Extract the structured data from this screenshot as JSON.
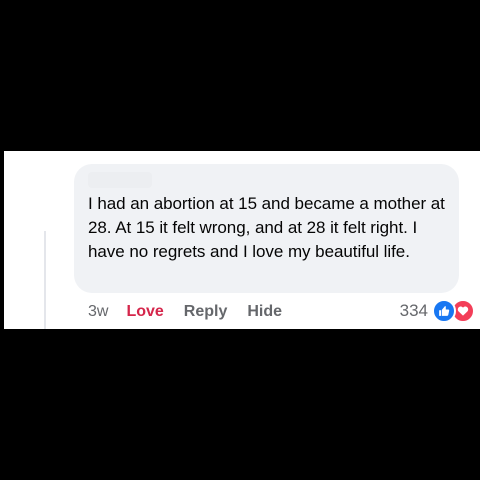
{
  "comment": {
    "text": "I had an abortion at 15 and became a mother at 28. At 15 it felt wrong, and at 28 it felt right. I have no regrets and I love my beautiful life."
  },
  "actions": {
    "timestamp": "3w",
    "love_label": "Love",
    "reply_label": "Reply",
    "hide_label": "Hide"
  },
  "reactions": {
    "count": "334",
    "icons": [
      "like-icon",
      "heart-icon"
    ],
    "like_color": "#1877f2",
    "love_color": "#f33e58"
  },
  "colors": {
    "bubble": "#f0f2f5",
    "love_active": "#d5264b",
    "meta_text": "#65676b"
  }
}
